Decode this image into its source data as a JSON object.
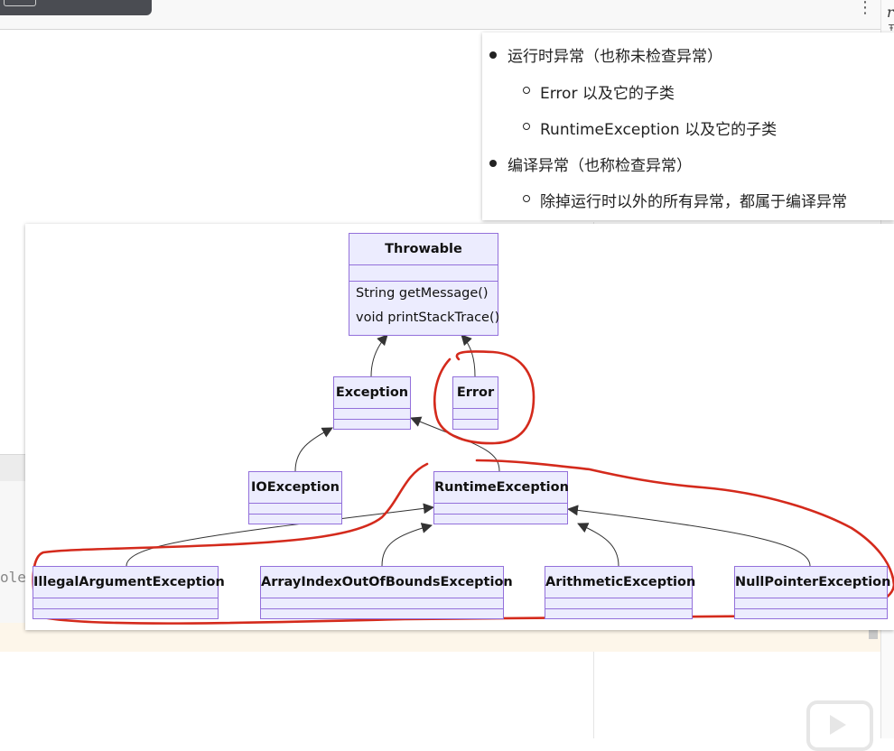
{
  "popup": {
    "items": [
      {
        "level": 1,
        "text": "运行时异常（也称未检查异常）"
      },
      {
        "level": 2,
        "text": "Error 以及它的子类"
      },
      {
        "level": 2,
        "text": "RuntimeException 以及它的子类"
      },
      {
        "level": 1,
        "text": "编译异常（也称检查异常）"
      },
      {
        "level": 2,
        "text": "除掉运行时以外的所有异常，都属于编译异常"
      }
    ]
  },
  "diagram": {
    "classes": {
      "throwable": {
        "name": "Throwable",
        "methods": [
          "String getMessage()",
          "void printStackTrace()"
        ]
      },
      "exception": {
        "name": "Exception"
      },
      "error": {
        "name": "Error"
      },
      "ioexception": {
        "name": "IOException"
      },
      "runtimeexception": {
        "name": "RuntimeException"
      },
      "illegalargument": {
        "name": "IllegalArgumentException"
      },
      "arrayindex": {
        "name": "ArrayIndexOutOfBoundsException"
      },
      "arithmetic": {
        "name": "ArithmeticException"
      },
      "nullpointer": {
        "name": "NullPointerException"
      }
    },
    "annotation_color": "#d42a1c",
    "class_fill": "#ececfe",
    "class_border": "#9370db"
  },
  "background": {
    "code_fragment": "ole",
    "gutter_char": "r",
    "gutter_char2": "Ŧ",
    "menu_icon": "⋮"
  }
}
